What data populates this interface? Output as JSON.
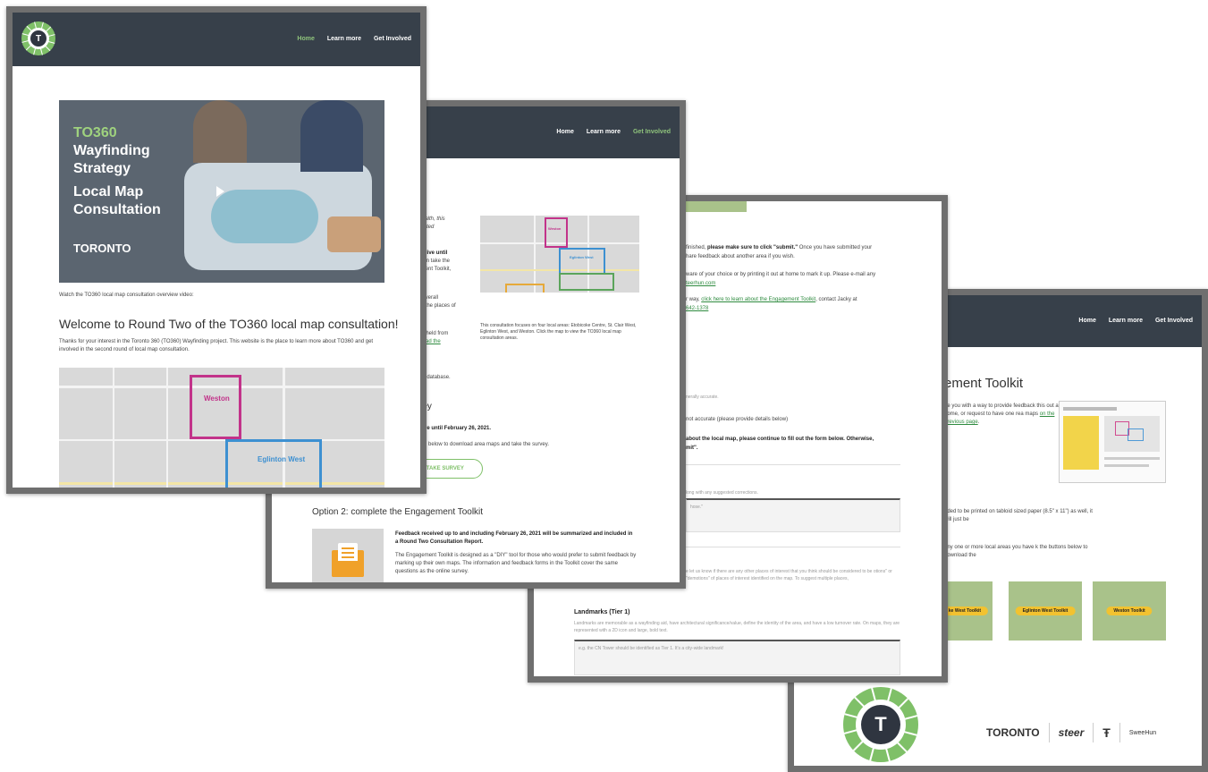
{
  "page1": {
    "nav": [
      "Home",
      "Learn more",
      "Get Involved"
    ],
    "logo_letter": "T",
    "video": {
      "line1": "TO360",
      "line2": "Wayfinding",
      "line3": "Strategy",
      "line4": "Local Map",
      "line5": "Consultation",
      "brand": "TORONTO",
      "play_icon": "play-icon"
    },
    "caption": "Watch the TO360 local map consultation overview video:",
    "heading": "Welcome to Round Two of the TO360 local map consultation!",
    "intro": "Thanks for your interest in the Toronto 360 (TO360) Wayfinding project. This website is the place to learn more about TO360 and get involved in the second round of local map consultation.",
    "map_labels": [
      "Weston",
      "Eglinton West"
    ]
  },
  "page2": {
    "nav": [
      "Home",
      "Learn more",
      "Get Involved"
    ],
    "text_fragments": [
      "c health, this",
      "nducted",
      "n is live until",
      "ts can take the",
      "gement Toolkit,",
      "he overall",
      "and the places of",
      "was held from",
      "to read the",
      "rm",
      "map database.",
      "rvey",
      "is live until February 26, 2021.",
      "utton below to download area maps and take the survey."
    ],
    "button": "S & TAKE SURVEY",
    "map_caption": "This consultation focuses on four local areas: Etobicoke Centre, St. Clair West, Eglinton West, and Weston. Click the map to view the TO360 local map consultation areas.",
    "map_labels": [
      "Weston",
      "Eglinton West",
      "Etobicoke Centre",
      "St. Clair West"
    ],
    "option2_heading": "Option 2: complete the Engagement Toolkit",
    "feedback_bold": "Feedback received up to and including February 26, 2021 will be summarized and included in a Round Two Consultation Report.",
    "toolkit_desc": "The Engagement Toolkit is designed as a \"DIY\" tool for those who would prefer to submit feedback by marking up their own maps. The information and feedback forms in the Toolkit cover the same questions as the online survey."
  },
  "page3": {
    "line1_pre": "finished, ",
    "line1_bold": "please make sure to click \"submit.\"",
    "line1_post": " Once you have submitted your",
    "line2": "hare feedback about another area if you wish.",
    "line3": "ware of your choice or by printing it out at home to mark it up. Please e-mail any",
    "line4_link": "teerhun.com",
    "line5_pre": "r way, ",
    "line5_link": "click here to learn about the Engagement Toolkit",
    "line5_post": ", contact Jacky at",
    "line6_link": "642-1378",
    "accurate": "nerally accurate.",
    "not_accurate": "not accurate (please provide details below)",
    "about_bold": "about the local map, please continue to fill out the form below. Otherwise,",
    "mit": "mit\".",
    "suggested": "long with any suggested corrections.",
    "field1_placeholder": "hose.\"",
    "places_text": "e let us know if there are any other places of interest that you think should be considered to be otions\" or \"demotions\" of places of interest identified on the map. To suggest multiple places,",
    "landmarks_heading": "Landmarks (Tier 1)",
    "landmarks_desc": "Landmarks are memorable as a wayfinding aid, have architectural significance/value, define the identity of the area, and have a low turnover rate. On maps, they are represented with a 2D icon and large, bold text.",
    "field2_placeholder": "e.g. the CN Tower should be identified as Tier 1. It's a city-wide landmark!"
  },
  "page4": {
    "nav": [
      "Home",
      "Learn more",
      "Get Involved"
    ],
    "heading": "ement Toolkit",
    "para1": "de you with a way to provide feedback this out at home, or request to have one rea maps",
    "para1_link": "on the previous page",
    "para2": "nded to be printed on tabloid sized paper (8.5\" x 11\") as well, it will just be",
    "para3": "any one or more local areas you have k the buttons below to download the",
    "toolkits": [
      "Weston Toolkit",
      "Eglinton West Toolkit",
      "Weston Toolkit"
    ],
    "toolkit_first": "ke West Toolkit",
    "logo_letter": "T",
    "partners": [
      "TORONTO",
      "steer",
      "SweeHun"
    ]
  }
}
